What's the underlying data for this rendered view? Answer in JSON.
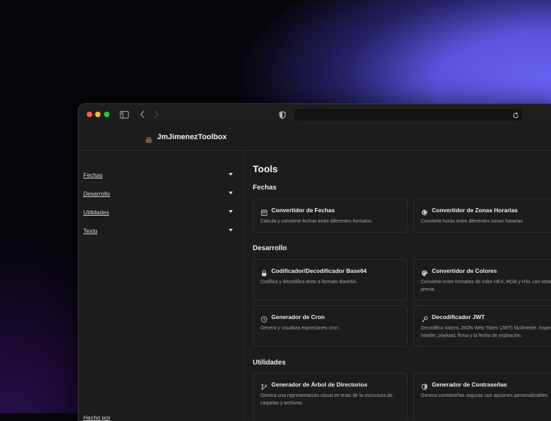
{
  "app": {
    "title": "JmJimenezToolbox"
  },
  "sidebar": {
    "items": [
      {
        "label": "Fechas"
      },
      {
        "label": "Desarrollo"
      },
      {
        "label": "Utilidades"
      },
      {
        "label": "Texto"
      }
    ],
    "footer": "Hecho por"
  },
  "main": {
    "title": "Tools",
    "sections": [
      {
        "title": "Fechas",
        "cards": [
          {
            "title": "Convertidor de Fechas",
            "desc": "Calcula y convierte fechas entre diferentes formatos.",
            "icon": "calendar-icon"
          },
          {
            "title": "Convertidor de Zonas Horarias",
            "desc": "Convierte horas entre diferentes zonas horarias.",
            "icon": "globe-icon"
          }
        ]
      },
      {
        "title": "Desarrollo",
        "cards": [
          {
            "title": "Codificador/Decodificador Base64",
            "desc": "Codifica y decodifica texto a formato Base64.",
            "icon": "lock-icon"
          },
          {
            "title": "Convertidor de Colores",
            "desc": "Convierte entre formatos de color HEX, RGB y HSL con vista previa.",
            "icon": "palette-icon"
          },
          {
            "title": "Generador de Cron",
            "desc": "Genera y visualiza expresiones cron.",
            "icon": "clock-icon"
          },
          {
            "title": "Decodificador JWT",
            "desc": "Decodifica tokens JSON Web Token (JWT) fácilmente. Inspecciona el header, payload, firma y la fecha de expiración.",
            "icon": "key-icon"
          }
        ]
      },
      {
        "title": "Utilidades",
        "cards": [
          {
            "title": "Generador de Árbol de Directorios",
            "desc": "Genera una representación visual en texto de la estructura de carpetas y archivos.",
            "icon": "git-branch-icon"
          },
          {
            "title": "Generador de Contraseñas",
            "desc": "Genera contraseñas seguras con opciones personalizables.",
            "icon": "shield-icon"
          }
        ]
      }
    ]
  },
  "colors": {
    "accent": "#6a63f6",
    "window_bg": "#1c1c1c",
    "card_border": "#2e2e2e"
  }
}
